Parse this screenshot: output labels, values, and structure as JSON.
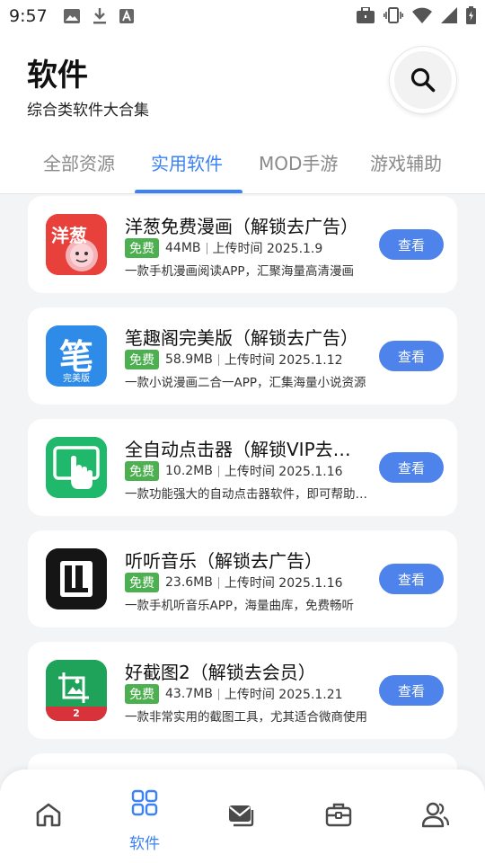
{
  "status_bar": {
    "time": "9:57"
  },
  "header": {
    "title": "软件",
    "subtitle": "综合类软件大合集"
  },
  "tabs": [
    {
      "label": "全部资源",
      "active": false
    },
    {
      "label": "实用软件",
      "active": true
    },
    {
      "label": "MOD手游",
      "active": false
    },
    {
      "label": "游戏辅助",
      "active": false
    }
  ],
  "apps": [
    {
      "name": "洋葱免费漫画（解锁去广告）",
      "badge": "免费",
      "size": "44MB",
      "upload": "上传时间 2025.1.9",
      "desc": "一款手机漫画阅读APP，汇聚海量高清漫画",
      "button": "查看",
      "icon_text": "洋葱"
    },
    {
      "name": "笔趣阁完美版（解锁去广告）",
      "badge": "免费",
      "size": "58.9MB",
      "upload": "上传时间 2025.1.12",
      "desc": "一款小说漫画二合一APP，汇集海量小说资源",
      "button": "查看",
      "icon_text": "笔",
      "icon_sub": "完美版"
    },
    {
      "name": "全自动点击器（解锁VIP去广告）",
      "badge": "免费",
      "size": "10.2MB",
      "upload": "上传时间 2025.1.16",
      "desc": "一款功能强大的自动点击器软件，即可帮助用户",
      "button": "查看"
    },
    {
      "name": "听听音乐（解锁去广告）",
      "badge": "免费",
      "size": "23.6MB",
      "upload": "上传时间 2025.1.16",
      "desc": "一款手机听音乐APP，海量曲库，免费畅听",
      "button": "查看"
    },
    {
      "name": "好截图2（解锁去会员）",
      "badge": "免费",
      "size": "43.7MB",
      "upload": "上传时间 2025.1.21",
      "desc": "一款非常实用的截图工具，尤其适合微商使用",
      "button": "查看",
      "icon_text": "2"
    }
  ],
  "bottom_nav": [
    {
      "icon": "home-icon",
      "label": ""
    },
    {
      "icon": "grid-icon",
      "label": "软件",
      "active": true
    },
    {
      "icon": "mail-icon",
      "label": ""
    },
    {
      "icon": "toolbox-icon",
      "label": ""
    },
    {
      "icon": "users-icon",
      "label": ""
    }
  ],
  "colors": {
    "accent": "#3b82f6",
    "button": "#4f83ec",
    "free_badge": "#4caf50",
    "background": "#f3f4f6"
  }
}
